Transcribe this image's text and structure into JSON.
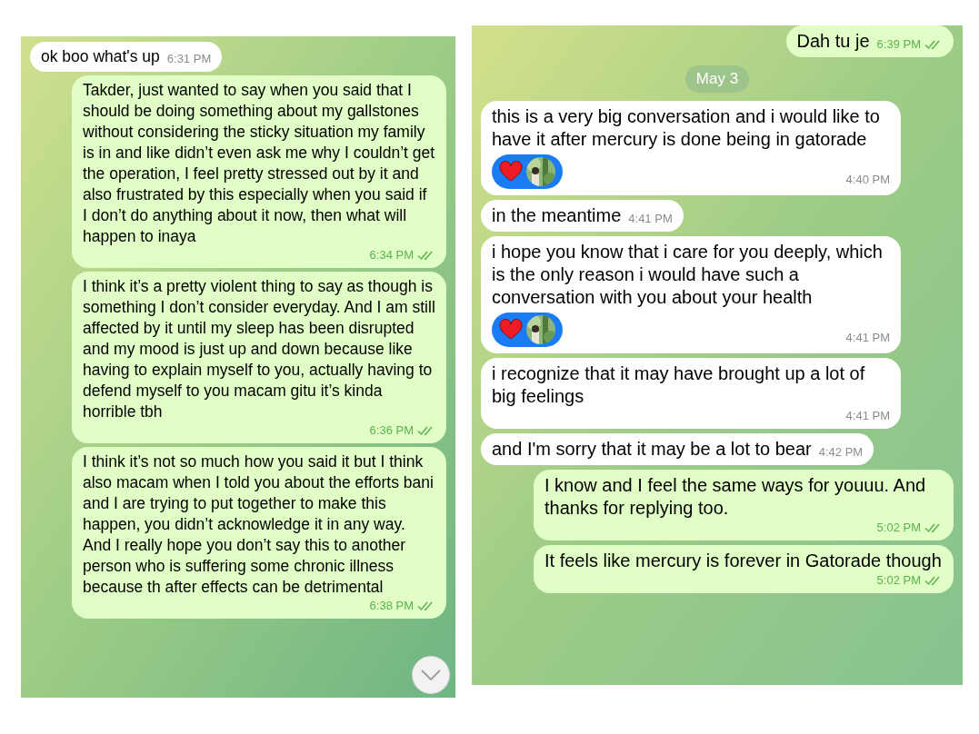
{
  "left_chat": {
    "messages": [
      {
        "kind": "them",
        "text": "ok boo what's up",
        "time": "6:31 PM"
      },
      {
        "kind": "me",
        "text": "Takder, just wanted to say when you said that I should be doing something about my gallstones without considering the sticky situation my family is in and like didn’t even ask me why I couldn’t get the operation, I feel pretty stressed out by it and also frustrated by this especially when you said if I don’t do anything about it now, then what will happen to inaya",
        "time": "6:34 PM"
      },
      {
        "kind": "me",
        "text": "I think it’s a pretty violent thing to say as though is something I don’t consider everyday. And I am still affected by it until my sleep has been disrupted and my mood is just up and down because like having to explain myself to you, actually having to defend myself to you macam gitu it’s kinda horrible tbh",
        "time": "6:36 PM"
      },
      {
        "kind": "me",
        "text": "I think it’s not so much how you said it but I think also macam when I told you about the efforts bani and I are trying to put together to make this happen, you didn’t acknowledge it in any way. And I really hope you don’t say this to another person who is suffering some chronic illness because th after effects can be detrimental",
        "time": "6:38 PM"
      }
    ]
  },
  "right_chat": {
    "messages": [
      {
        "kind": "me",
        "text": "Dah tu je",
        "time": "6:39 PM"
      },
      {
        "kind": "date",
        "text": "May 3"
      },
      {
        "kind": "them",
        "text": "this is a very big conversation and i would like to have it after mercury is done being in gatorade",
        "time": "4:40 PM",
        "reaction": {
          "kind": "heart"
        }
      },
      {
        "kind": "them",
        "text": "in the meantime",
        "time": "4:41 PM"
      },
      {
        "kind": "them",
        "text": "i hope you know that i care for you deeply, which is the only reason i would have such a conversation with you about your health",
        "time": "4:41 PM",
        "reaction": {
          "kind": "heart"
        }
      },
      {
        "kind": "them",
        "text": "i recognize that it may have brought up a lot of big feelings",
        "time": "4:41 PM"
      },
      {
        "kind": "them",
        "text": "and I'm sorry that it may be a lot to bear",
        "time": "4:42 PM"
      },
      {
        "kind": "me",
        "text": "I know and I feel the same ways for youuu. And thanks for replying too.",
        "time": "5:02 PM"
      },
      {
        "kind": "me",
        "text": "It feels like mercury is forever in Gatorade though",
        "time": "5:02 PM"
      }
    ]
  }
}
